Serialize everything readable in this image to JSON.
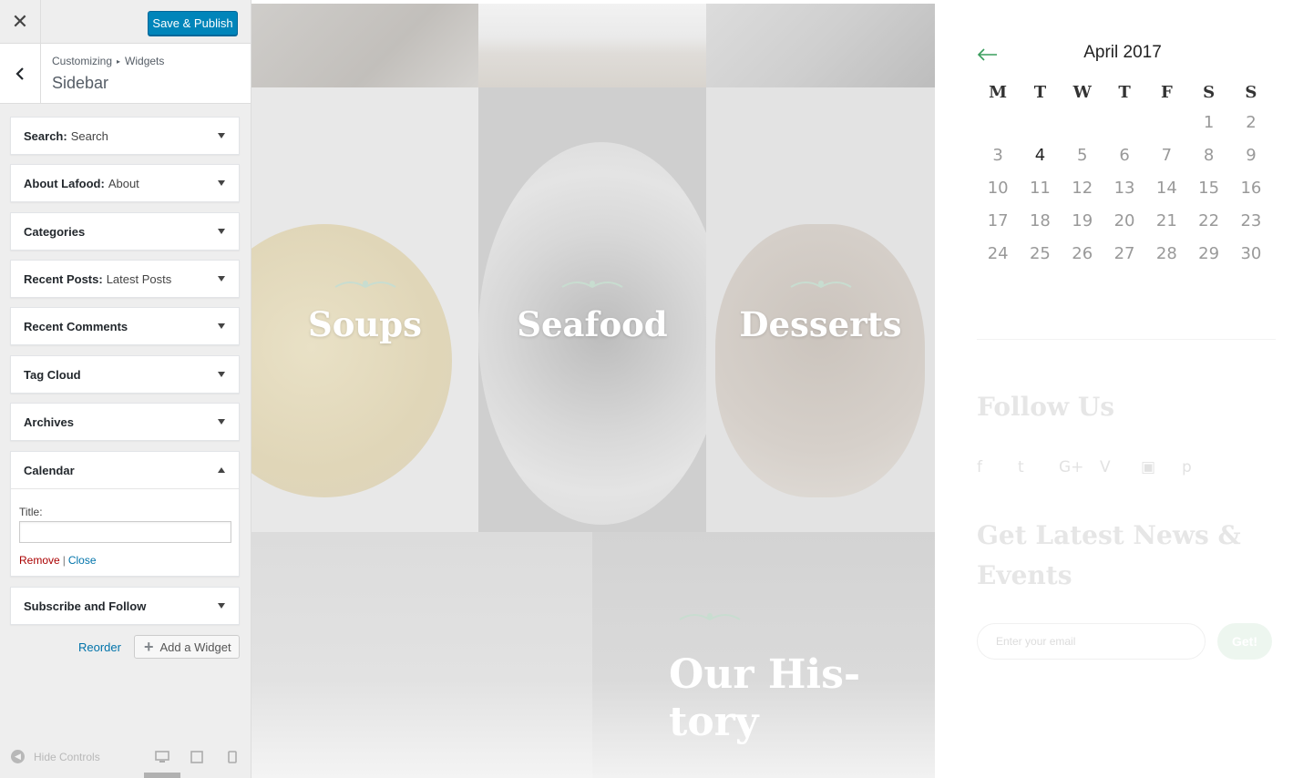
{
  "customizer": {
    "close_label": "✕",
    "save_label": "Save & Publish",
    "breadcrumb": {
      "root": "Customizing",
      "current": "Widgets"
    },
    "section_title": "Sidebar",
    "widgets": [
      {
        "name": "Search:",
        "sub": "Search"
      },
      {
        "name": "About Lafood:",
        "sub": "About"
      },
      {
        "name": "Categories",
        "sub": ""
      },
      {
        "name": "Recent Posts:",
        "sub": "Latest Posts"
      },
      {
        "name": "Recent Comments",
        "sub": ""
      },
      {
        "name": "Tag Cloud",
        "sub": ""
      },
      {
        "name": "Archives",
        "sub": ""
      },
      {
        "name": "Calendar",
        "sub": ""
      },
      {
        "name": "Subscribe and Follow",
        "sub": ""
      }
    ],
    "calendar_widget": {
      "title_label": "Title:",
      "title_value": "",
      "remove_label": "Remove",
      "separator": "|",
      "close_label": "Close"
    },
    "reorder_label": "Reorder",
    "add_widget_label": "Add a Widget",
    "hide_controls_label": "Hide Controls"
  },
  "preview": {
    "tiles": [
      "Soups",
      "Seafood",
      "Desserts"
    ],
    "history_title": "Our His- tory",
    "calendar": {
      "month": "April 2017",
      "prev_icon": "arrow-left-icon",
      "weekdays": [
        "M",
        "T",
        "W",
        "T",
        "F",
        "S",
        "S"
      ],
      "weeks": [
        [
          "",
          "",
          "",
          "",
          "",
          "1",
          "2"
        ],
        [
          "3",
          "4",
          "5",
          "6",
          "7",
          "8",
          "9"
        ],
        [
          "10",
          "11",
          "12",
          "13",
          "14",
          "15",
          "16"
        ],
        [
          "17",
          "18",
          "19",
          "20",
          "21",
          "22",
          "23"
        ],
        [
          "24",
          "25",
          "26",
          "27",
          "28",
          "29",
          "30"
        ]
      ],
      "today": "4",
      "accent_color": "#3a9d5d"
    },
    "follow_title": "Follow Us",
    "social_icons": [
      "facebook-icon",
      "twitter-icon",
      "google-plus-icon",
      "vimeo-icon",
      "youtube-icon",
      "pinterest-icon"
    ],
    "social_glyphs": [
      "f",
      "t",
      "G+",
      "V",
      "▣",
      "p"
    ],
    "news_title": "Get Latest News & Events",
    "email_placeholder": "Enter your email",
    "get_label": "Get!"
  }
}
